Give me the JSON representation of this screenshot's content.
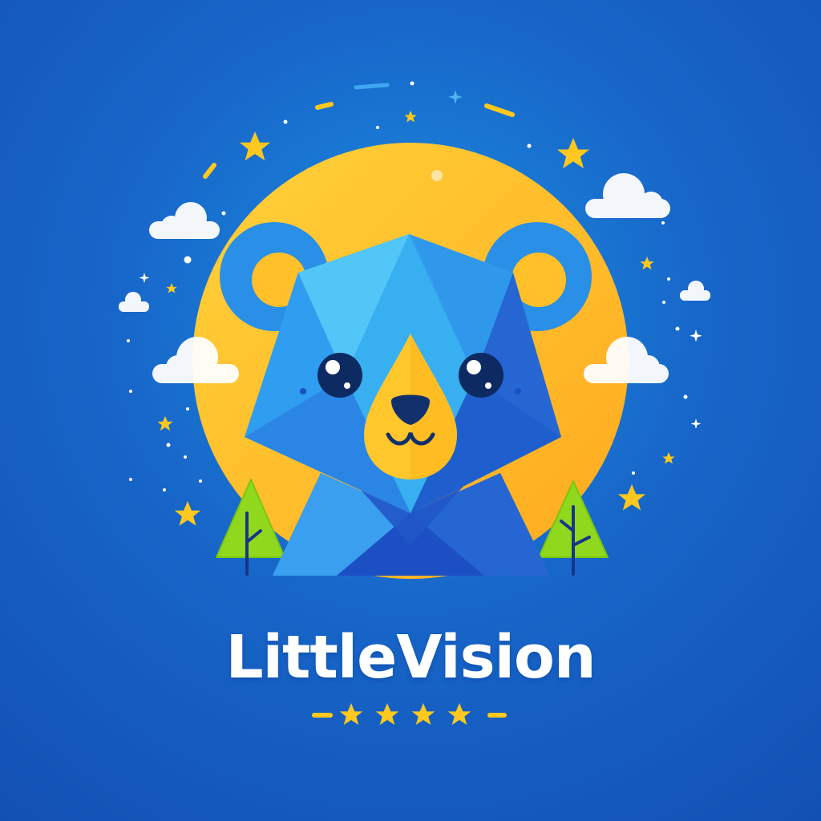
{
  "brand": {
    "name": "LittleVision"
  },
  "logo": {
    "mascot": "origami-bear",
    "rating_stars": 4,
    "icons": [
      "bear-icon",
      "sun-icon",
      "cloud-icon",
      "star-icon",
      "tree-icon"
    ]
  },
  "colors": {
    "background_center": "#1d8fe0",
    "background_edge": "#1350b4",
    "sun": "#ffc02a",
    "bear_light": "#3bbcf5",
    "bear_mid": "#2a8fe6",
    "bear_dark": "#1b4fc3",
    "muzzle": "#ffc72c",
    "nose": "#12306b",
    "tree": "#8fd81e",
    "star": "#ffc81e",
    "cloud": "#ffffff",
    "text": "#ffffff"
  }
}
